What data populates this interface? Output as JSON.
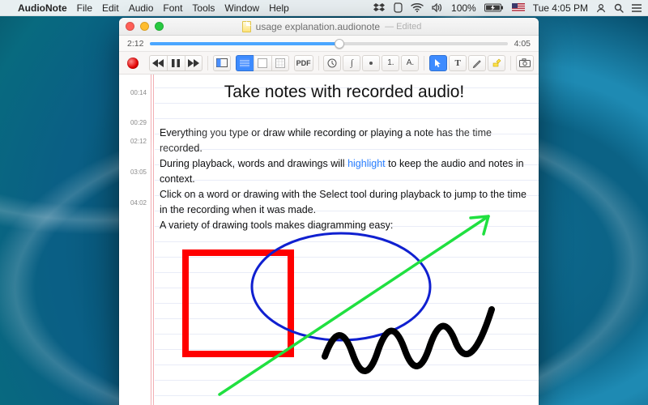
{
  "menubar": {
    "app_name": "AudioNote",
    "items": [
      "File",
      "Edit",
      "Audio",
      "Font",
      "Tools",
      "Window",
      "Help"
    ],
    "status": {
      "battery_pct": "100%",
      "clock": "Tue 4:05 PM"
    }
  },
  "window": {
    "doc_title": "usage explanation.audionote",
    "edited_label": "— Edited"
  },
  "timeline": {
    "current": "2:12",
    "total": "4:05",
    "progress_pct": 53
  },
  "toolbar": {
    "pdf_label": "PDF",
    "number_label": "1.",
    "letter_label": "A.",
    "text_tool_label": "T"
  },
  "note": {
    "title": "Take notes with recorded audio!",
    "entries": [
      {
        "ts": "00:14",
        "text": ""
      },
      {
        "ts": "00:29",
        "text": "Everything you type or draw while recording or playing a note has the time recorded."
      },
      {
        "ts": "02:12",
        "text_pre": "During playback, words and drawings will ",
        "highlight": "highlight",
        "text_post": " to keep the audio and notes in context."
      },
      {
        "ts": "03:05",
        "text": "Click on a word or drawing with the Select tool during playback to jump to the time in the recording when it was made."
      },
      {
        "ts": "04:02",
        "text": "A variety of drawing tools makes diagramming easy:"
      }
    ]
  },
  "drawings": {
    "square_color": "#ff0000",
    "ellipse_color": "#1020d0",
    "arrow_color": "#20e040",
    "squiggle_color": "#000000"
  },
  "icons": {
    "apple": "apple-icon",
    "dropbox": "dropbox-icon",
    "evernote": "evernote-icon",
    "wifi": "wifi-icon",
    "volume": "volume-icon",
    "battery": "battery-icon",
    "flag": "flag-us-icon",
    "spotlight": "search-icon",
    "user": "user-icon",
    "menu": "menu-icon"
  }
}
